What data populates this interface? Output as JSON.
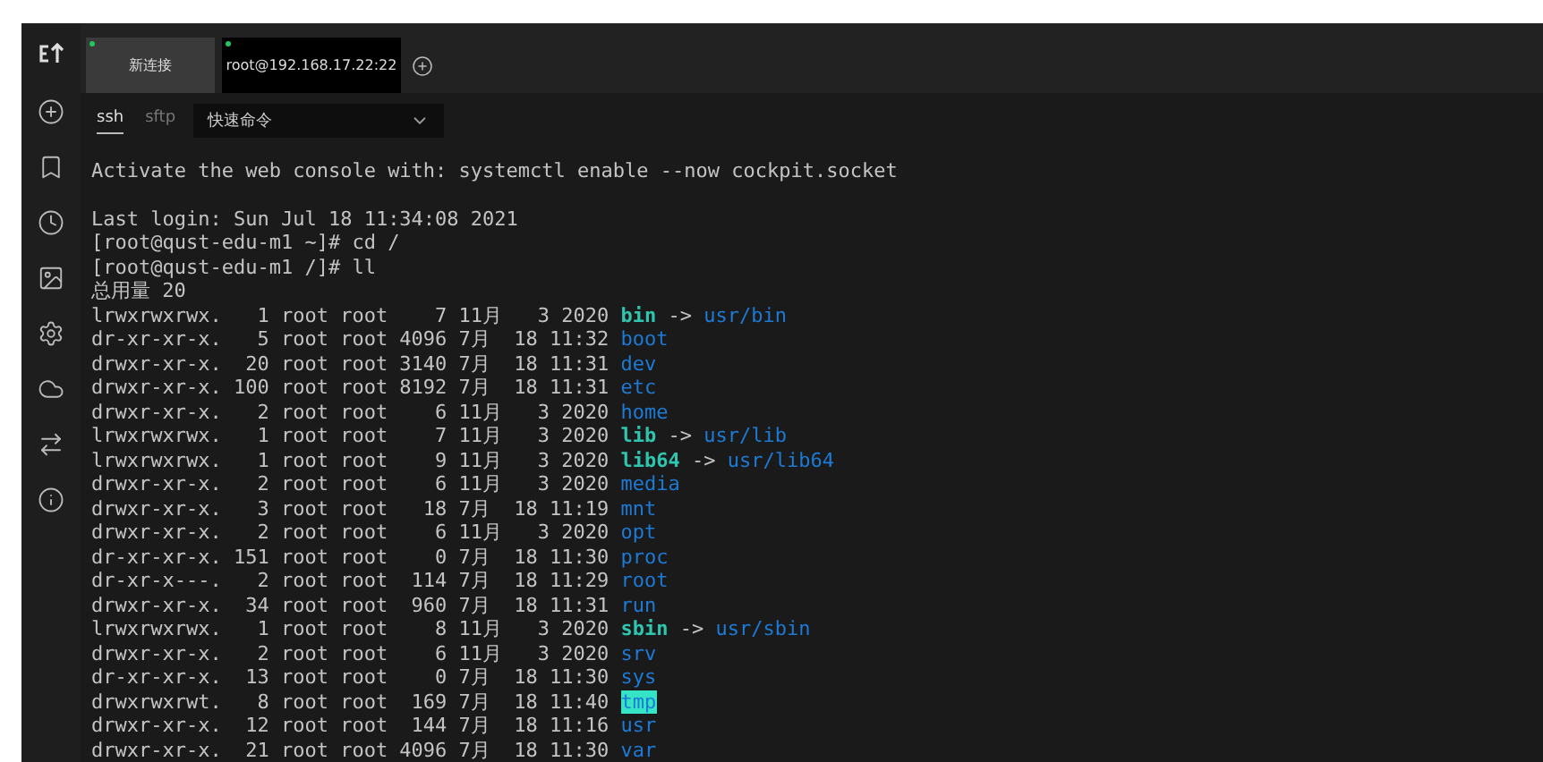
{
  "tabs": [
    {
      "label": "新连接",
      "selected": false,
      "connected": true
    },
    {
      "label": "root@192.168.17.22:22",
      "selected": true,
      "connected": true
    }
  ],
  "session_tabs": [
    {
      "label": "ssh",
      "selected": true
    },
    {
      "label": "sftp",
      "selected": false
    }
  ],
  "quick_command": {
    "value": "快速命令"
  },
  "motd": "Activate the web console with: systemctl enable --now cockpit.socket",
  "terminal_lines": [
    [
      {
        "text": "Last login: Sun Jul 18 11:34:08 2021",
        "kind": "plain"
      }
    ],
    [
      {
        "text": "[root@qust-edu-m1 ~]# cd /",
        "kind": "plain"
      }
    ],
    [
      {
        "text": "[root@qust-edu-m1 /]# ll",
        "kind": "plain"
      }
    ],
    [
      {
        "text": "总用量 20",
        "kind": "plain"
      }
    ],
    [
      {
        "text": "lrwxrwxrwx.   1 root root    7 11月   3 2020 ",
        "kind": "plain"
      },
      {
        "text": "bin",
        "kind": "link"
      },
      {
        "text": " -> ",
        "kind": "plain"
      },
      {
        "text": "usr/bin",
        "kind": "dir"
      }
    ],
    [
      {
        "text": "dr-xr-xr-x.   5 root root 4096 7月  18 11:32 ",
        "kind": "plain"
      },
      {
        "text": "boot",
        "kind": "dir"
      }
    ],
    [
      {
        "text": "drwxr-xr-x.  20 root root 3140 7月  18 11:31 ",
        "kind": "plain"
      },
      {
        "text": "dev",
        "kind": "dir"
      }
    ],
    [
      {
        "text": "drwxr-xr-x. 100 root root 8192 7月  18 11:31 ",
        "kind": "plain"
      },
      {
        "text": "etc",
        "kind": "dir"
      }
    ],
    [
      {
        "text": "drwxr-xr-x.   2 root root    6 11月   3 2020 ",
        "kind": "plain"
      },
      {
        "text": "home",
        "kind": "dir"
      }
    ],
    [
      {
        "text": "lrwxrwxrwx.   1 root root    7 11月   3 2020 ",
        "kind": "plain"
      },
      {
        "text": "lib",
        "kind": "link"
      },
      {
        "text": " -> ",
        "kind": "plain"
      },
      {
        "text": "usr/lib",
        "kind": "dir"
      }
    ],
    [
      {
        "text": "lrwxrwxrwx.   1 root root    9 11月   3 2020 ",
        "kind": "plain"
      },
      {
        "text": "lib64",
        "kind": "link"
      },
      {
        "text": " -> ",
        "kind": "plain"
      },
      {
        "text": "usr/lib64",
        "kind": "dir"
      }
    ],
    [
      {
        "text": "drwxr-xr-x.   2 root root    6 11月   3 2020 ",
        "kind": "plain"
      },
      {
        "text": "media",
        "kind": "dir"
      }
    ],
    [
      {
        "text": "drwxr-xr-x.   3 root root   18 7月  18 11:19 ",
        "kind": "plain"
      },
      {
        "text": "mnt",
        "kind": "dir"
      }
    ],
    [
      {
        "text": "drwxr-xr-x.   2 root root    6 11月   3 2020 ",
        "kind": "plain"
      },
      {
        "text": "opt",
        "kind": "dir"
      }
    ],
    [
      {
        "text": "dr-xr-xr-x. 151 root root    0 7月  18 11:30 ",
        "kind": "plain"
      },
      {
        "text": "proc",
        "kind": "dir"
      }
    ],
    [
      {
        "text": "dr-xr-x---.   2 root root  114 7月  18 11:29 ",
        "kind": "plain"
      },
      {
        "text": "root",
        "kind": "dir"
      }
    ],
    [
      {
        "text": "drwxr-xr-x.  34 root root  960 7月  18 11:31 ",
        "kind": "plain"
      },
      {
        "text": "run",
        "kind": "dir"
      }
    ],
    [
      {
        "text": "lrwxrwxrwx.   1 root root    8 11月   3 2020 ",
        "kind": "plain"
      },
      {
        "text": "sbin",
        "kind": "link"
      },
      {
        "text": " -> ",
        "kind": "plain"
      },
      {
        "text": "usr/sbin",
        "kind": "dir"
      }
    ],
    [
      {
        "text": "drwxr-xr-x.   2 root root    6 11月   3 2020 ",
        "kind": "plain"
      },
      {
        "text": "srv",
        "kind": "dir"
      }
    ],
    [
      {
        "text": "dr-xr-xr-x.  13 root root    0 7月  18 11:30 ",
        "kind": "plain"
      },
      {
        "text": "sys",
        "kind": "dir"
      }
    ],
    [
      {
        "text": "drwxrwxrwt.   8 root root  169 7月  18 11:40 ",
        "kind": "plain"
      },
      {
        "text": "tmp",
        "kind": "sticky"
      }
    ],
    [
      {
        "text": "drwxr-xr-x.  12 root root  144 7月  18 11:16 ",
        "kind": "plain"
      },
      {
        "text": "usr",
        "kind": "dir"
      }
    ],
    [
      {
        "text": "drwxr-xr-x.  21 root root 4096 7月  18 11:30 ",
        "kind": "plain"
      },
      {
        "text": "var",
        "kind": "dir"
      }
    ]
  ]
}
